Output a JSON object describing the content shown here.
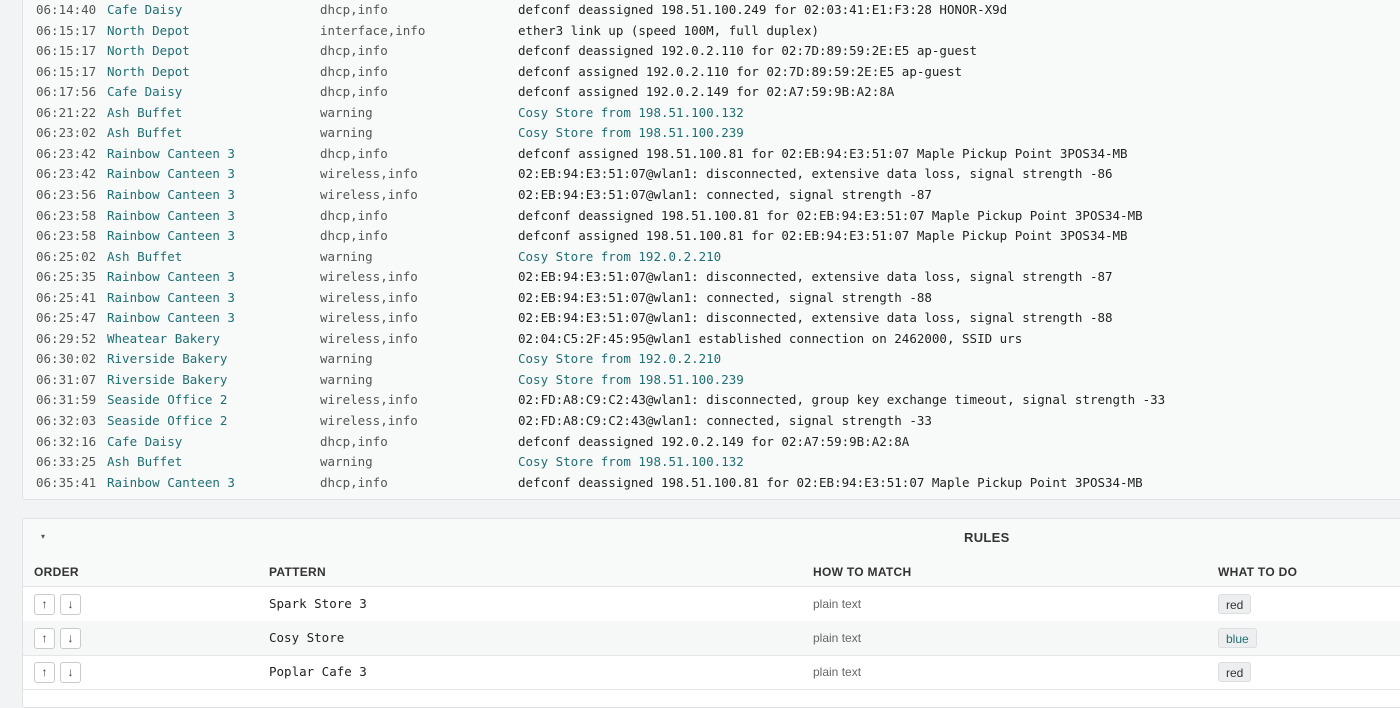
{
  "log": {
    "rows": [
      {
        "time": "06:14:40",
        "source": "Cafe Daisy",
        "topics": "dhcp,info",
        "message": "defconf deassigned 198.51.100.249 for 02:03:41:E1:F3:28 HONOR-X9d",
        "highlight": false
      },
      {
        "time": "06:15:17",
        "source": "North Depot",
        "topics": "interface,info",
        "message": "ether3 link up (speed 100M, full duplex)",
        "highlight": false
      },
      {
        "time": "06:15:17",
        "source": "North Depot",
        "topics": "dhcp,info",
        "message": "defconf deassigned 192.0.2.110 for 02:7D:89:59:2E:E5 ap-guest",
        "highlight": false
      },
      {
        "time": "06:15:17",
        "source": "North Depot",
        "topics": "dhcp,info",
        "message": "defconf assigned 192.0.2.110 for 02:7D:89:59:2E:E5 ap-guest",
        "highlight": false
      },
      {
        "time": "06:17:56",
        "source": "Cafe Daisy",
        "topics": "dhcp,info",
        "message": "defconf assigned 192.0.2.149 for 02:A7:59:9B:A2:8A",
        "highlight": false
      },
      {
        "time": "06:21:22",
        "source": "Ash Buffet",
        "topics": "warning",
        "message": "Cosy Store from 198.51.100.132",
        "highlight": true
      },
      {
        "time": "06:23:02",
        "source": "Ash Buffet",
        "topics": "warning",
        "message": "Cosy Store from 198.51.100.239",
        "highlight": true
      },
      {
        "time": "06:23:42",
        "source": "Rainbow Canteen 3",
        "topics": "dhcp,info",
        "message": "defconf assigned 198.51.100.81 for 02:EB:94:E3:51:07 Maple Pickup Point 3POS34-MB",
        "highlight": false
      },
      {
        "time": "06:23:42",
        "source": "Rainbow Canteen 3",
        "topics": "wireless,info",
        "message": "02:EB:94:E3:51:07@wlan1: disconnected, extensive data loss, signal strength -86",
        "highlight": false
      },
      {
        "time": "06:23:56",
        "source": "Rainbow Canteen 3",
        "topics": "wireless,info",
        "message": "02:EB:94:E3:51:07@wlan1: connected, signal strength -87",
        "highlight": false
      },
      {
        "time": "06:23:58",
        "source": "Rainbow Canteen 3",
        "topics": "dhcp,info",
        "message": "defconf deassigned 198.51.100.81 for 02:EB:94:E3:51:07 Maple Pickup Point 3POS34-MB",
        "highlight": false
      },
      {
        "time": "06:23:58",
        "source": "Rainbow Canteen 3",
        "topics": "dhcp,info",
        "message": "defconf assigned 198.51.100.81 for 02:EB:94:E3:51:07 Maple Pickup Point 3POS34-MB",
        "highlight": false
      },
      {
        "time": "06:25:02",
        "source": "Ash Buffet",
        "topics": "warning",
        "message": "Cosy Store from 192.0.2.210",
        "highlight": true
      },
      {
        "time": "06:25:35",
        "source": "Rainbow Canteen 3",
        "topics": "wireless,info",
        "message": "02:EB:94:E3:51:07@wlan1: disconnected, extensive data loss, signal strength -87",
        "highlight": false
      },
      {
        "time": "06:25:41",
        "source": "Rainbow Canteen 3",
        "topics": "wireless,info",
        "message": "02:EB:94:E3:51:07@wlan1: connected, signal strength -88",
        "highlight": false
      },
      {
        "time": "06:25:47",
        "source": "Rainbow Canteen 3",
        "topics": "wireless,info",
        "message": "02:EB:94:E3:51:07@wlan1: disconnected, extensive data loss, signal strength -88",
        "highlight": false
      },
      {
        "time": "06:29:52",
        "source": "Wheatear Bakery",
        "topics": "wireless,info",
        "message": "02:04:C5:2F:45:95@wlan1 established connection on 2462000, SSID urs",
        "highlight": false
      },
      {
        "time": "06:30:02",
        "source": "Riverside Bakery",
        "topics": "warning",
        "message": "Cosy Store from 192.0.2.210",
        "highlight": true
      },
      {
        "time": "06:31:07",
        "source": "Riverside Bakery",
        "topics": "warning",
        "message": "Cosy Store from 198.51.100.239",
        "highlight": true
      },
      {
        "time": "06:31:59",
        "source": "Seaside Office 2",
        "topics": "wireless,info",
        "message": "02:FD:A8:C9:C2:43@wlan1: disconnected, group key exchange timeout, signal strength -33",
        "highlight": false
      },
      {
        "time": "06:32:03",
        "source": "Seaside Office 2",
        "topics": "wireless,info",
        "message": "02:FD:A8:C9:C2:43@wlan1: connected, signal strength -33",
        "highlight": false
      },
      {
        "time": "06:32:16",
        "source": "Cafe Daisy",
        "topics": "dhcp,info",
        "message": "defconf deassigned 192.0.2.149 for 02:A7:59:9B:A2:8A",
        "highlight": false
      },
      {
        "time": "06:33:25",
        "source": "Ash Buffet",
        "topics": "warning",
        "message": "Cosy Store from 198.51.100.132",
        "highlight": true
      },
      {
        "time": "06:35:41",
        "source": "Rainbow Canteen 3",
        "topics": "dhcp,info",
        "message": "defconf deassigned 198.51.100.81 for 02:EB:94:E3:51:07 Maple Pickup Point 3POS34-MB",
        "highlight": false
      }
    ]
  },
  "rules": {
    "title": "RULES",
    "toggle_icon": "▾",
    "columns": {
      "order": "ORDER",
      "pattern": "PATTERN",
      "how": "HOW TO MATCH",
      "what": "WHAT TO DO"
    },
    "up_icon": "↑",
    "down_icon": "↓",
    "items": [
      {
        "pattern": "Spark Store 3",
        "how": "plain text",
        "action": "red",
        "action_color": "#333333"
      },
      {
        "pattern": "Cosy Store",
        "how": "plain text",
        "action": "blue",
        "action_color": "#1f6f73"
      },
      {
        "pattern": "Poplar Cafe 3",
        "how": "plain text",
        "action": "red",
        "action_color": "#333333"
      }
    ]
  }
}
